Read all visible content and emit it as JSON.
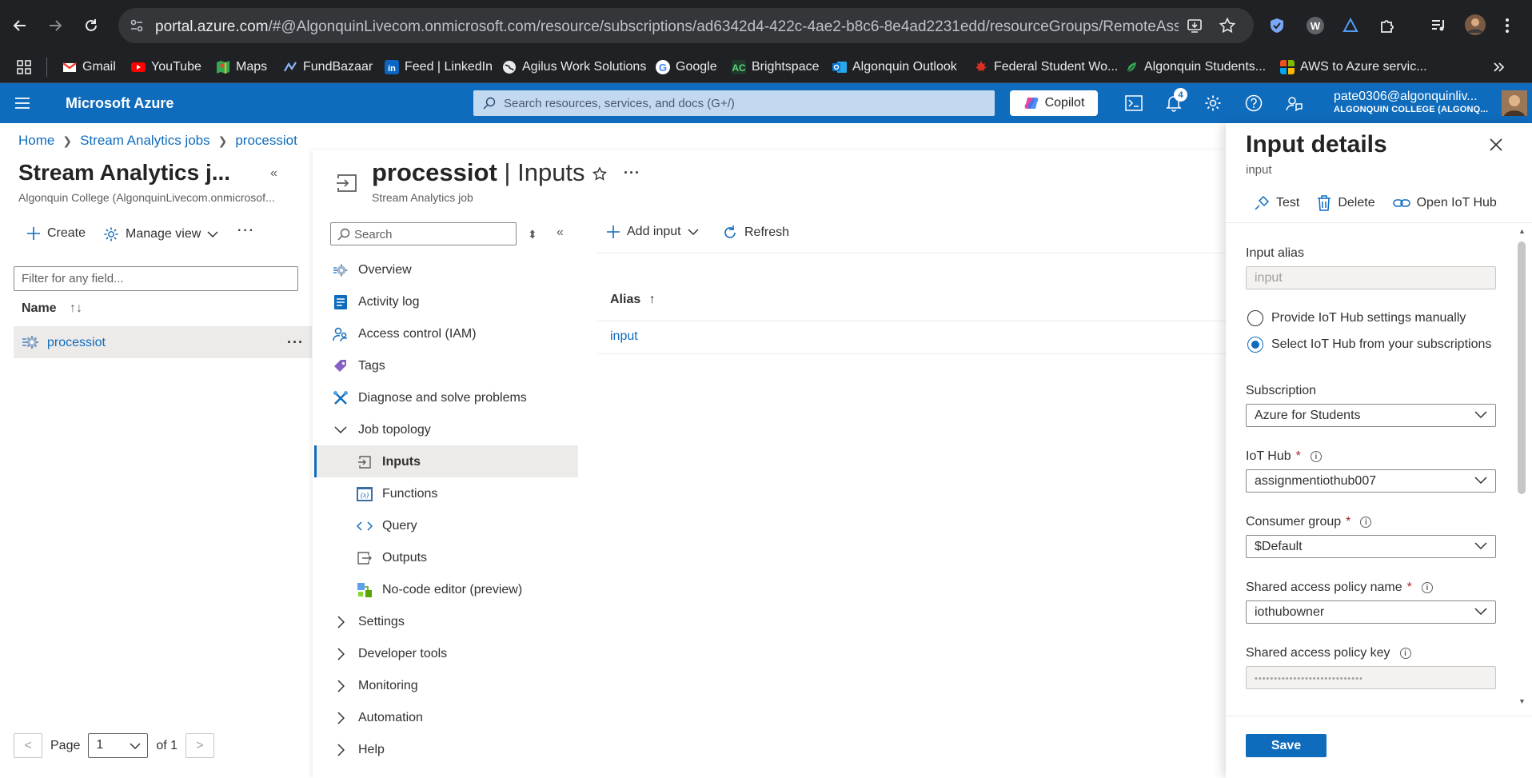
{
  "browser": {
    "url_host": "portal.azure.com",
    "url_rest": "/#@AlgonquinLivecom.onmicrosoft.com/resource/subscriptions/ad6342d4-422c-4ae2-b8c6-8e4ad2231edd/resourceGroups/RemoteAssignment/p..."
  },
  "bookmarks": [
    {
      "label": "Gmail",
      "color": "#ea4335"
    },
    {
      "label": "YouTube",
      "color": "#ff0000"
    },
    {
      "label": "Maps",
      "color": "#34a853"
    },
    {
      "label": "FundBazaar",
      "color": "#1a73e8"
    },
    {
      "label": "Feed | LinkedIn",
      "color": "#0a66c2"
    },
    {
      "label": "Agilus Work Solutions",
      "color": "#e8eaed"
    },
    {
      "label": "Google",
      "color": "#4285f4"
    },
    {
      "label": "Brightspace",
      "color": "#1e8e3e"
    },
    {
      "label": "Algonquin Outlook",
      "color": "#0078d4"
    },
    {
      "label": "Federal Student Wo...",
      "color": "#d93025"
    },
    {
      "label": "Algonquin Students...",
      "color": "#34a853"
    },
    {
      "label": "AWS to Azure servic...",
      "color": "#f25022"
    }
  ],
  "header": {
    "brand": "Microsoft Azure",
    "search_placeholder": "Search resources, services, and docs (G+/)",
    "copilot": "Copilot",
    "notifications_count": "4",
    "user": "pate0306@algonquinliv...",
    "tenant": "ALGONQUIN COLLEGE (ALGONQ..."
  },
  "breadcrumb": [
    "Home",
    "Stream Analytics jobs",
    "processiot"
  ],
  "list": {
    "title": "Stream Analytics j...",
    "subtitle": "Algonquin College (AlgonquinLivecom.onmicrosof...",
    "create": "Create",
    "manage_view": "Manage view",
    "filter_placeholder": "Filter for any field...",
    "name_col": "Name",
    "rows": [
      {
        "name": "processiot"
      }
    ],
    "pager": {
      "page_label": "Page",
      "page": "1",
      "of": "of 1"
    }
  },
  "blade": {
    "resource": "processiot",
    "section": "Inputs",
    "separator": "|",
    "subtitle": "Stream Analytics job",
    "search_placeholder": "Search",
    "menu": [
      {
        "label": "Overview",
        "icon": "gear-icon"
      },
      {
        "label": "Activity log",
        "icon": "activity-log-icon"
      },
      {
        "label": "Access control (IAM)",
        "icon": "people-icon"
      },
      {
        "label": "Tags",
        "icon": "tag-icon"
      },
      {
        "label": "Diagnose and solve problems",
        "icon": "wrench-icon"
      },
      {
        "label": "Job topology",
        "icon": "chevron-down-icon"
      },
      {
        "label": "Inputs",
        "icon": "input-icon"
      },
      {
        "label": "Functions",
        "icon": "function-icon"
      },
      {
        "label": "Query",
        "icon": "code-icon"
      },
      {
        "label": "Outputs",
        "icon": "output-icon"
      },
      {
        "label": "No-code editor (preview)",
        "icon": "nocode-icon"
      },
      {
        "label": "Settings",
        "icon": "chevron-right-icon"
      },
      {
        "label": "Developer tools",
        "icon": "chevron-right-icon"
      },
      {
        "label": "Monitoring",
        "icon": "chevron-right-icon"
      },
      {
        "label": "Automation",
        "icon": "chevron-right-icon"
      },
      {
        "label": "Help",
        "icon": "chevron-right-icon"
      }
    ],
    "toolbar": {
      "add_input": "Add input",
      "refresh": "Refresh"
    },
    "grid": {
      "column": "Alias",
      "sort_arrow": "↑",
      "rows": [
        "input"
      ]
    }
  },
  "flyout": {
    "title": "Input details",
    "subtitle": "input",
    "commands": {
      "test": "Test",
      "delete": "Delete",
      "open_iot_hub": "Open IoT Hub"
    },
    "input_alias_label": "Input alias",
    "input_alias_value": "input",
    "radio_manual": "Provide IoT Hub settings manually",
    "radio_subscription": "Select IoT Hub from your subscriptions",
    "subscription_label": "Subscription",
    "subscription_value": "Azure for Students",
    "iot_hub_label": "IoT Hub",
    "iot_hub_value": "assignmentiothub007",
    "consumer_group_label": "Consumer group",
    "consumer_group_value": "$Default",
    "policy_name_label": "Shared access policy name",
    "policy_name_value": "iothubowner",
    "policy_key_label": "Shared access policy key",
    "policy_key_value": "••••••••••••••••••••••••••••",
    "required_mark": "*",
    "save": "Save"
  },
  "colors": {
    "azure_blue": "#0f6cbd",
    "chrome_dark": "#202124",
    "selected_row": "#edebe9"
  }
}
